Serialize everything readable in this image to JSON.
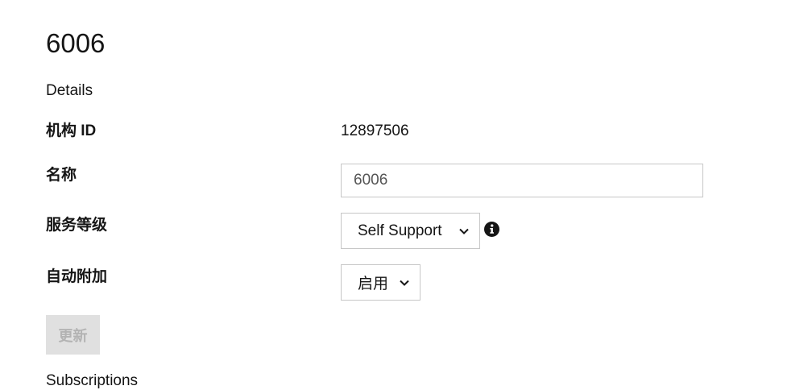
{
  "page": {
    "title": "6006",
    "details_heading": "Details",
    "subscriptions_heading": "Subscriptions"
  },
  "fields": {
    "org_id": {
      "label": "机构 ID",
      "value": "12897506"
    },
    "name": {
      "label": "名称",
      "value": "6006"
    },
    "service_level": {
      "label": "服务等级",
      "selected": "Self Support",
      "info_icon": "info-circle-icon"
    },
    "auto_attach": {
      "label": "自动附加",
      "selected": "启用"
    }
  },
  "actions": {
    "update_label": "更新",
    "update_disabled": true
  },
  "colors": {
    "text": "#151515",
    "border": "#c7c7c7",
    "disabled_button_bg": "#e0e0e0",
    "disabled_button_text": "#b3b3b3"
  }
}
